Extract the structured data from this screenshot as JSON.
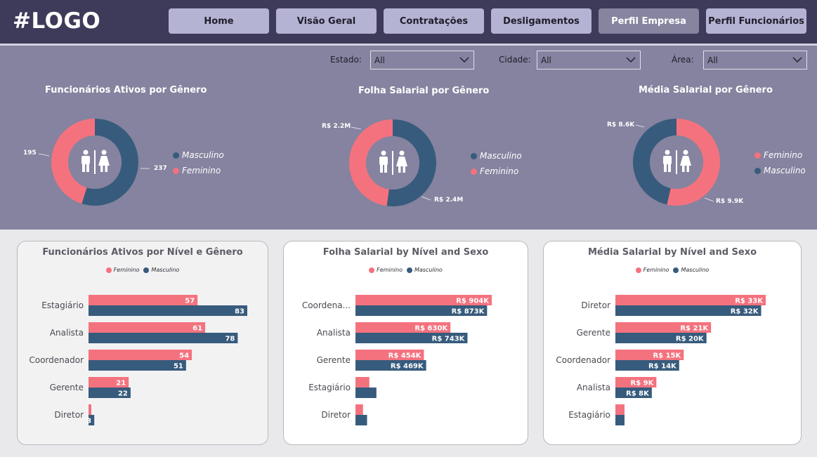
{
  "logo": "#LOGO",
  "nav": [
    {
      "label": "Home",
      "active": false
    },
    {
      "label": "Visão Geral",
      "active": false
    },
    {
      "label": "Contratações",
      "active": false
    },
    {
      "label": "Desligamentos",
      "active": false
    },
    {
      "label": "Perfil Empresa",
      "active": true
    },
    {
      "label": "Perfil Funcionários",
      "active": false
    }
  ],
  "filters": [
    {
      "label": "Estado:",
      "value": "All"
    },
    {
      "label": "Cidade:",
      "value": "All"
    },
    {
      "label": "Área:",
      "value": "All"
    }
  ],
  "colors": {
    "feminino": "#f4727e",
    "masculino": "#375b7c",
    "header_bg": "#3e3a5a",
    "panel_bg": "#85839f"
  },
  "icons": [
    "restroom-icon",
    "chevron-down-icon"
  ],
  "donuts": [
    {
      "title": "Funcionários Ativos por Gênero",
      "legend": [
        "Masculino",
        "Feminino"
      ],
      "chart_data": {
        "type": "pie",
        "title": "Funcionários Ativos por Gênero",
        "series": [
          {
            "name": "Masculino",
            "value": 237,
            "label": "237"
          },
          {
            "name": "Feminino",
            "value": 195,
            "label": "195"
          }
        ]
      }
    },
    {
      "title": "Folha Salarial por Gênero",
      "legend": [
        "Masculino",
        "Feminino"
      ],
      "chart_data": {
        "type": "pie",
        "title": "Folha Salarial por Gênero",
        "series": [
          {
            "name": "Masculino",
            "value": 2.4,
            "label": "R$ 2.4M"
          },
          {
            "name": "Feminino",
            "value": 2.2,
            "label": "R$ 2.2M"
          }
        ]
      }
    },
    {
      "title": "Média Salarial  por Gênero",
      "legend": [
        "Feminino",
        "Masculino"
      ],
      "chart_data": {
        "type": "pie",
        "title": "Média Salarial  por Gênero",
        "series": [
          {
            "name": "Feminino",
            "value": 9.9,
            "label": "R$ 9.9K"
          },
          {
            "name": "Masculino",
            "value": 8.6,
            "label": "R$ 8.6K"
          }
        ]
      }
    }
  ],
  "bar_charts": [
    {
      "title": "Funcionários Ativos por Nível e Gênero",
      "legend": [
        "Feminino",
        "Masculino"
      ],
      "chart_data": {
        "type": "bar",
        "orientation": "horizontal",
        "title": "Funcionários Ativos por Nível e Gênero",
        "categories": [
          "Estagiário",
          "Analista",
          "Coordenador",
          "Gerente",
          "Diretor"
        ],
        "series": [
          {
            "name": "Feminino",
            "values": [
              57,
              61,
              54,
              21,
              1
            ],
            "labels": [
              "57",
              "61",
              "54",
              "21",
              ""
            ]
          },
          {
            "name": "Masculino",
            "values": [
              83,
              78,
              51,
              22,
              3
            ],
            "labels": [
              "83",
              "78",
              "51",
              "22",
              "3"
            ]
          }
        ],
        "xlim": [
          0,
          83
        ]
      }
    },
    {
      "title": "Folha Salarial by Nível and Sexo",
      "legend": [
        "Feminino",
        "Masculino"
      ],
      "chart_data": {
        "type": "bar",
        "orientation": "horizontal",
        "title": "Folha Salarial by Nível and Sexo",
        "categories": [
          "Coordena...",
          "Analista",
          "Gerente",
          "Estagiário",
          "Diretor"
        ],
        "series": [
          {
            "name": "Feminino",
            "values": [
              904,
              630,
              454,
              92,
              50
            ],
            "labels": [
              "R$ 904K",
              "R$ 630K",
              "R$ 454K",
              "",
              ""
            ]
          },
          {
            "name": "Masculino",
            "values": [
              873,
              743,
              469,
              139,
              77
            ],
            "labels": [
              "R$ 873K",
              "R$ 743K",
              "R$ 469K",
              "",
              ""
            ]
          }
        ],
        "xlim": [
          0,
          904
        ]
      }
    },
    {
      "title": "Média Salarial by Nível and Sexo",
      "legend": [
        "Feminino",
        "Masculino"
      ],
      "chart_data": {
        "type": "bar",
        "orientation": "horizontal",
        "title": "Média Salarial by Nível and Sexo",
        "categories": [
          "Diretor",
          "Gerente",
          "Coordenador",
          "Analista",
          "Estagiário"
        ],
        "series": [
          {
            "name": "Feminino",
            "values": [
              33,
              21,
              15,
              9,
              2
            ],
            "labels": [
              "R$ 33K",
              "R$ 21K",
              "R$ 15K",
              "R$ 9K",
              ""
            ]
          },
          {
            "name": "Masculino",
            "values": [
              32,
              20,
              14,
              8,
              2
            ],
            "labels": [
              "R$ 32K",
              "R$ 20K",
              "R$ 14K",
              "R$ 8K",
              ""
            ]
          }
        ],
        "xlim": [
          0,
          33
        ]
      }
    }
  ]
}
